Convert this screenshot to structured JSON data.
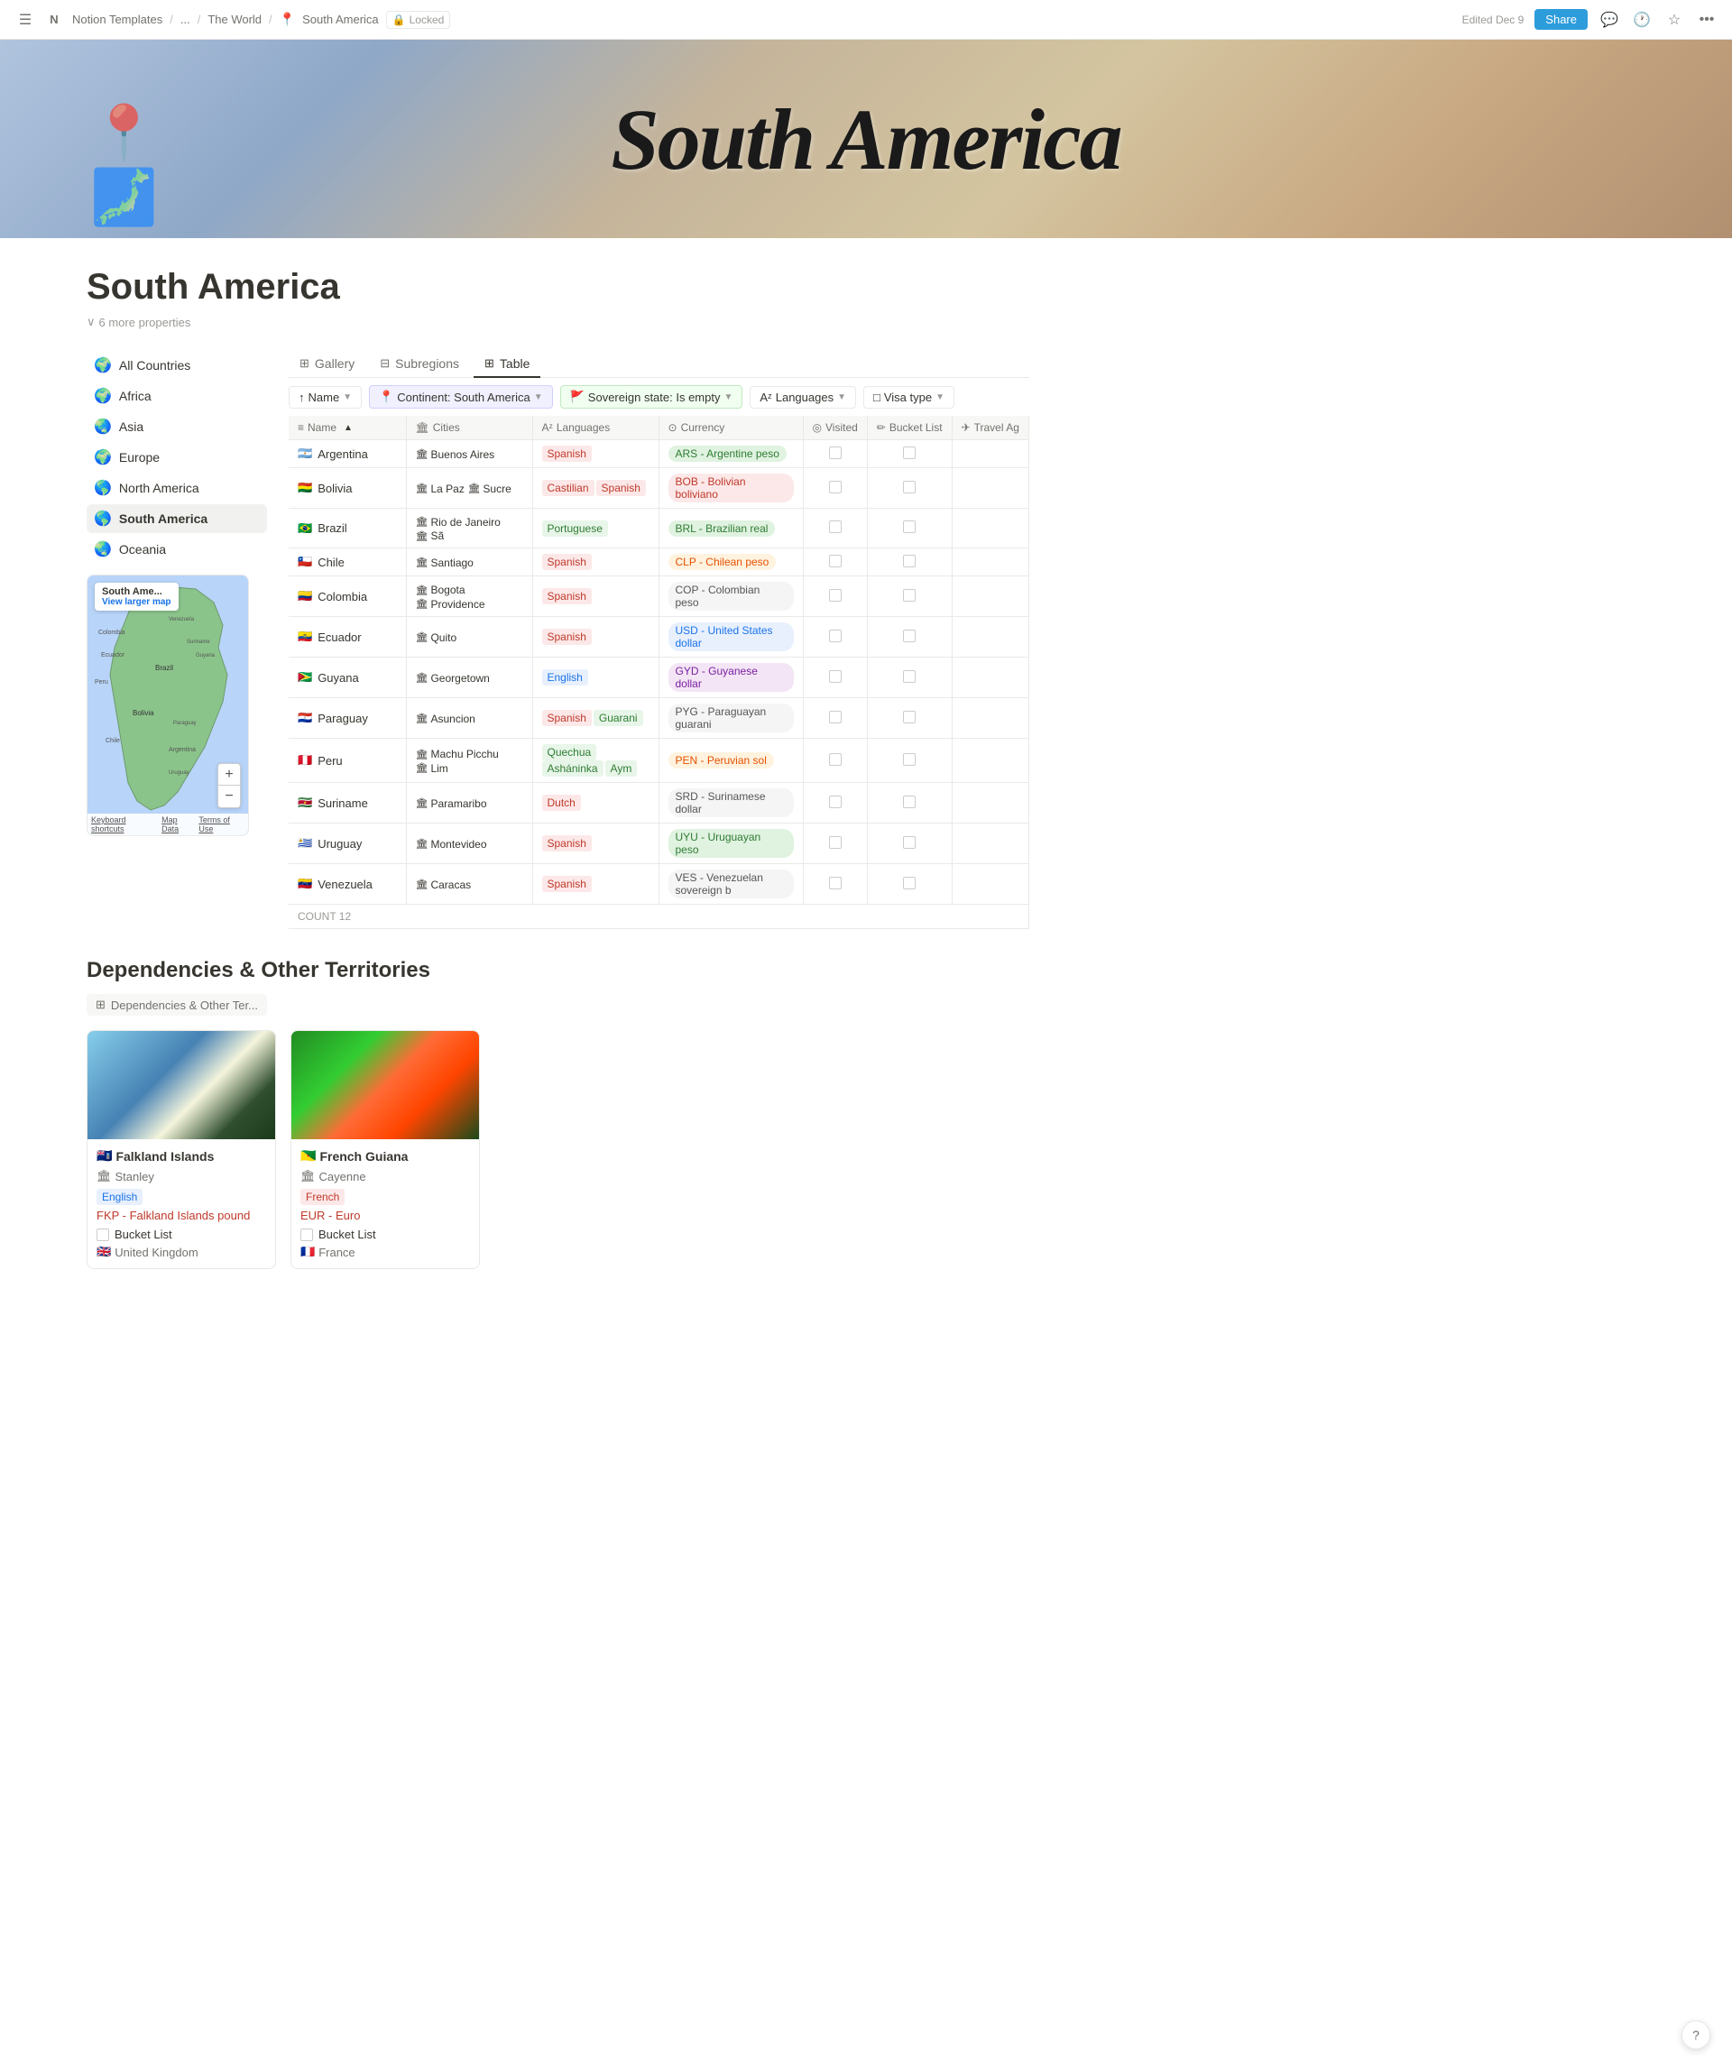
{
  "topbar": {
    "menu_icon": "☰",
    "notion_icon": "N",
    "breadcrumb": [
      "Notion Templates",
      "...",
      "The World",
      "South America"
    ],
    "lock_label": "Locked",
    "edited": "Edited Dec 9",
    "share_label": "Share"
  },
  "hero": {
    "title": "South America",
    "icon": "📍"
  },
  "page": {
    "title": "South America",
    "more_props": "6 more properties"
  },
  "sidebar": {
    "items": [
      {
        "emoji": "🌍",
        "label": "All Countries"
      },
      {
        "emoji": "🌍",
        "label": "Africa"
      },
      {
        "emoji": "🌏",
        "label": "Asia"
      },
      {
        "emoji": "🌍",
        "label": "Europe"
      },
      {
        "emoji": "🌎",
        "label": "North America"
      },
      {
        "emoji": "🌎",
        "label": "South America",
        "active": true
      },
      {
        "emoji": "🌏",
        "label": "Oceania"
      }
    ],
    "map": {
      "label": "South Ame...",
      "link": "View larger map"
    }
  },
  "database": {
    "tabs": [
      {
        "icon": "⊞",
        "label": "Gallery"
      },
      {
        "icon": "⊟",
        "label": "Subregions"
      },
      {
        "icon": "⊞",
        "label": "Table",
        "active": true
      }
    ],
    "filters": [
      {
        "icon": "↑",
        "label": "Name",
        "type": "sort"
      },
      {
        "icon": "📍",
        "label": "Continent: South America",
        "type": "filter-accent"
      },
      {
        "icon": "🚩",
        "label": "Sovereign state: Is empty",
        "type": "filter-accent2"
      },
      {
        "icon": "Aᶻ",
        "label": "Languages",
        "type": "filter"
      },
      {
        "icon": "□",
        "label": "Visa type",
        "type": "filter"
      }
    ],
    "columns": [
      "Name",
      "Cities",
      "Languages",
      "Currency",
      "Visited",
      "Bucket List",
      "Travel Ag"
    ],
    "rows": [
      {
        "flag": "🇦🇷",
        "name": "Argentina",
        "cities": [
          {
            "icon": "🏛",
            "name": "Buenos Aires"
          }
        ],
        "languages": [
          {
            "label": "Spanish",
            "class": "lang-spanish"
          }
        ],
        "currency": "ARS - Argentine peso",
        "curr_class": "curr-green",
        "visited": false,
        "bucket": false
      },
      {
        "flag": "🇧🇴",
        "name": "Bolivia",
        "cities": [
          {
            "icon": "🏛",
            "name": "La Paz"
          },
          {
            "icon": "🏛",
            "name": "Sucre"
          }
        ],
        "languages": [
          {
            "label": "Castilian",
            "class": "lang-castilian"
          },
          {
            "label": "Spanish",
            "class": "lang-spanish"
          }
        ],
        "currency": "BOB - Bolivian boliviano",
        "curr_class": "curr-red",
        "visited": false,
        "bucket": false
      },
      {
        "flag": "🇧🇷",
        "name": "Brazil",
        "cities": [
          {
            "icon": "🏛",
            "name": "Rio de Janeiro"
          },
          {
            "icon": "🏛",
            "name": "Sã"
          }
        ],
        "languages": [
          {
            "label": "Portuguese",
            "class": "lang-portuguese"
          }
        ],
        "currency": "BRL - Brazilian real",
        "curr_class": "curr-green",
        "visited": false,
        "bucket": false
      },
      {
        "flag": "🇨🇱",
        "name": "Chile",
        "cities": [
          {
            "icon": "🏛",
            "name": "Santiago"
          }
        ],
        "languages": [
          {
            "label": "Spanish",
            "class": "lang-spanish"
          }
        ],
        "currency": "CLP - Chilean peso",
        "curr_class": "curr-orange",
        "visited": false,
        "bucket": false
      },
      {
        "flag": "🇨🇴",
        "name": "Colombia",
        "cities": [
          {
            "icon": "🏛",
            "name": "Bogota"
          },
          {
            "icon": "🏛",
            "name": "Providence"
          }
        ],
        "languages": [
          {
            "label": "Spanish",
            "class": "lang-spanish"
          }
        ],
        "currency": "COP - Colombian peso",
        "curr_class": "curr-gray",
        "visited": false,
        "bucket": false
      },
      {
        "flag": "🇪🇨",
        "name": "Ecuador",
        "cities": [
          {
            "icon": "🏛",
            "name": "Quito"
          }
        ],
        "languages": [
          {
            "label": "Spanish",
            "class": "lang-spanish"
          }
        ],
        "currency": "USD - United States dollar",
        "curr_class": "curr-blue",
        "visited": false,
        "bucket": false
      },
      {
        "flag": "🇬🇾",
        "name": "Guyana",
        "cities": [
          {
            "icon": "🏛",
            "name": "Georgetown"
          }
        ],
        "languages": [
          {
            "label": "English",
            "class": "lang-english"
          }
        ],
        "currency": "GYD - Guyanese dollar",
        "curr_class": "curr-purple",
        "visited": false,
        "bucket": false
      },
      {
        "flag": "🇵🇾",
        "name": "Paraguay",
        "cities": [
          {
            "icon": "🏛",
            "name": "Asuncion"
          }
        ],
        "languages": [
          {
            "label": "Spanish",
            "class": "lang-spanish"
          },
          {
            "label": "Guarani",
            "class": "lang-guarani"
          }
        ],
        "currency": "PYG - Paraguayan guarani",
        "curr_class": "curr-gray",
        "visited": false,
        "bucket": false
      },
      {
        "flag": "🇵🇪",
        "name": "Peru",
        "cities": [
          {
            "icon": "🏛",
            "name": "Machu Picchu"
          },
          {
            "icon": "🏛",
            "name": "Lim"
          }
        ],
        "languages": [
          {
            "label": "Quechua",
            "class": "lang-quechua"
          },
          {
            "label": "Asháninka",
            "class": "lang-ashaninka"
          },
          {
            "label": "Aym",
            "class": "lang-aymara"
          }
        ],
        "currency": "PEN - Peruvian sol",
        "curr_class": "curr-orange",
        "visited": false,
        "bucket": false
      },
      {
        "flag": "🇸🇷",
        "name": "Suriname",
        "cities": [
          {
            "icon": "🏛",
            "name": "Paramaribo"
          }
        ],
        "languages": [
          {
            "label": "Dutch",
            "class": "lang-dutch"
          }
        ],
        "currency": "SRD - Surinamese dollar",
        "curr_class": "curr-gray",
        "visited": false,
        "bucket": false
      },
      {
        "flag": "🇺🇾",
        "name": "Uruguay",
        "cities": [
          {
            "icon": "🏛",
            "name": "Montevideo"
          }
        ],
        "languages": [
          {
            "label": "Spanish",
            "class": "lang-spanish"
          }
        ],
        "currency": "UYU - Uruguayan peso",
        "curr_class": "curr-green",
        "visited": false,
        "bucket": false
      },
      {
        "flag": "🇻🇪",
        "name": "Venezuela",
        "cities": [
          {
            "icon": "🏛",
            "name": "Caracas"
          }
        ],
        "languages": [
          {
            "label": "Spanish",
            "class": "lang-spanish"
          }
        ],
        "currency": "VES - Venezuelan sovereign b",
        "curr_class": "curr-gray",
        "visited": false,
        "bucket": false
      }
    ],
    "count_label": "COUNT  12"
  },
  "dependencies": {
    "title": "Dependencies & Other Territories",
    "gallery_tab": "Dependencies & Other Ter...",
    "cards": [
      {
        "name": "Falkland Islands",
        "flag": "🇫🇰",
        "city": "Stanley",
        "city_icon": "🏛",
        "language": "English",
        "language_class": "lang-english",
        "currency": "FKP - Falkland Islands pound",
        "currency_class": "curr-red",
        "bucket": false,
        "sovereign": "United Kingdom",
        "sovereign_flag": "🇬🇧",
        "img_class": "card-img-falkland"
      },
      {
        "name": "French Guiana",
        "flag": "🇬🇫",
        "city": "Cayenne",
        "city_icon": "🏛",
        "language": "French",
        "language_class": "lang-french",
        "currency": "EUR - Euro",
        "currency_class": "curr-gray",
        "bucket": false,
        "sovereign": "France",
        "sovereign_flag": "🇫🇷",
        "img_class": "card-img-french"
      }
    ]
  }
}
